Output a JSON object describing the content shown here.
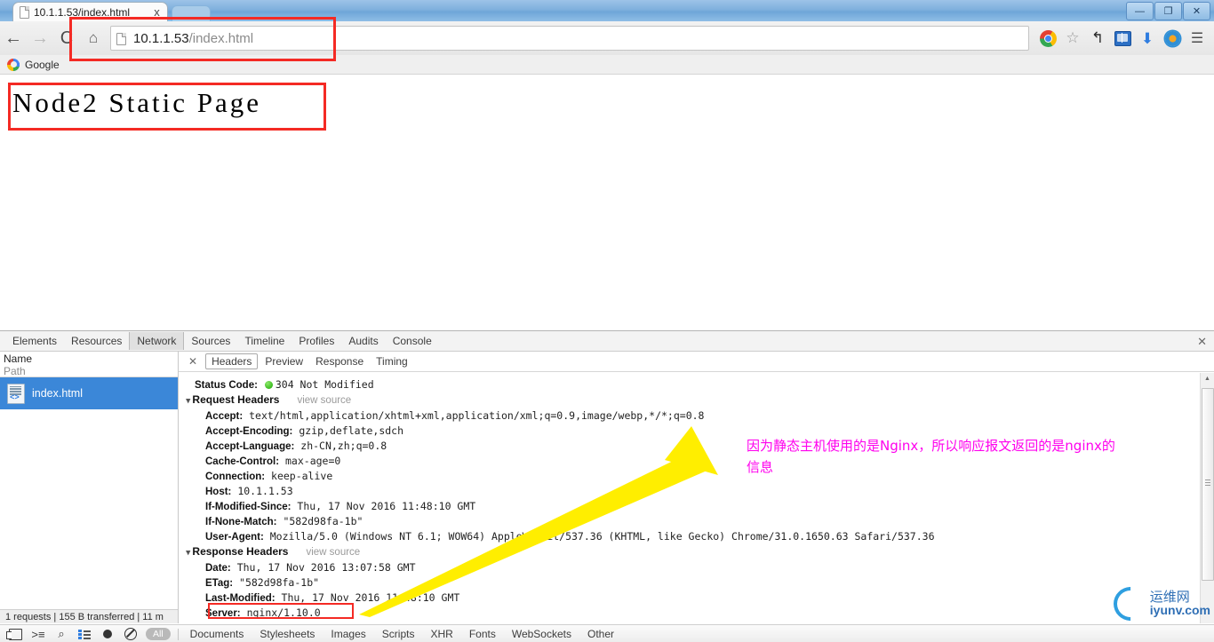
{
  "window": {
    "minimize_label": "—",
    "restore_label": "❐",
    "close_label": "✕"
  },
  "tab": {
    "title": "10.1.1.53/index.html",
    "close_label": "x",
    "favicon": "document-icon"
  },
  "toolbar": {
    "back_label": "←",
    "forward_label": "→",
    "reload_label": "C",
    "home_label": "⌂",
    "url": "10.1.1.53",
    "url_path": "/index.html",
    "star_label": "☆",
    "undo_label": "↰",
    "download_label": "⬇",
    "menu_label": "☰"
  },
  "bookmarks": {
    "items": [
      {
        "label": "Google",
        "icon": "google-g-icon"
      }
    ]
  },
  "page": {
    "heading": "Node2 Static Page"
  },
  "devtools": {
    "tabs": [
      {
        "label": "Elements",
        "active": false
      },
      {
        "label": "Resources",
        "active": false
      },
      {
        "label": "Network",
        "active": true
      },
      {
        "label": "Sources",
        "active": false
      },
      {
        "label": "Timeline",
        "active": false
      },
      {
        "label": "Profiles",
        "active": false
      },
      {
        "label": "Audits",
        "active": false
      },
      {
        "label": "Console",
        "active": false
      }
    ],
    "close_label": "✕",
    "network_list": {
      "col_name": "Name",
      "col_path": "Path",
      "rows": [
        {
          "name": "index.html",
          "icon": "html-document-icon",
          "selected": true
        }
      ]
    },
    "detail": {
      "close_label": "✕",
      "tabs": [
        {
          "label": "Headers",
          "active": true
        },
        {
          "label": "Preview",
          "active": false
        },
        {
          "label": "Response",
          "active": false
        },
        {
          "label": "Timing",
          "active": false
        }
      ],
      "status_code_label": "Status Code:",
      "status_code_value": "304 Not Modified",
      "status_color": "#18a800",
      "request_headers_title": "Request Headers",
      "view_source_label": "view source",
      "request_headers": [
        {
          "key": "Accept:",
          "value": "text/html,application/xhtml+xml,application/xml;q=0.9,image/webp,*/*;q=0.8"
        },
        {
          "key": "Accept-Encoding:",
          "value": "gzip,deflate,sdch"
        },
        {
          "key": "Accept-Language:",
          "value": "zh-CN,zh;q=0.8"
        },
        {
          "key": "Cache-Control:",
          "value": "max-age=0"
        },
        {
          "key": "Connection:",
          "value": "keep-alive"
        },
        {
          "key": "Host:",
          "value": "10.1.1.53"
        },
        {
          "key": "If-Modified-Since:",
          "value": "Thu, 17 Nov 2016 11:48:10 GMT"
        },
        {
          "key": "If-None-Match:",
          "value": "\"582d98fa-1b\""
        },
        {
          "key": "User-Agent:",
          "value": "Mozilla/5.0 (Windows NT 6.1; WOW64) AppleWebKit/537.36 (KHTML, like Gecko) Chrome/31.0.1650.63 Safari/537.36"
        }
      ],
      "response_headers_title": "Response Headers",
      "response_headers": [
        {
          "key": "Date:",
          "value": "Thu, 17 Nov 2016 13:07:58 GMT"
        },
        {
          "key": "ETag:",
          "value": "\"582d98fa-1b\""
        },
        {
          "key": "Last-Modified:",
          "value": "Thu, 17 Nov 2016 11:48:10 GMT"
        },
        {
          "key": "Server:",
          "value": "nginx/1.10.0"
        }
      ]
    },
    "status_bar": "1 requests | 155 B transferred | 11 m",
    "bottom_toolbar": {
      "icons": [
        "dock-panel-icon",
        "console-drawer-icon",
        "search-icon",
        "large-rows-icon",
        "record-icon",
        "clear-icon"
      ],
      "filter_all": "All",
      "filters": [
        "Documents",
        "Stylesheets",
        "Images",
        "Scripts",
        "XHR",
        "Fonts",
        "WebSockets",
        "Other"
      ]
    }
  },
  "annotations": {
    "note_line1": "因为静态主机使用的是Nginx，所以响应报文返回的是nginx的",
    "note_line2": "信息",
    "note_color": "#ff00ee",
    "arrow_color": "#ffee00",
    "highlight_color": "#f42a24"
  },
  "watermark": {
    "cn": "运维网",
    "en": "iyunv.com"
  }
}
